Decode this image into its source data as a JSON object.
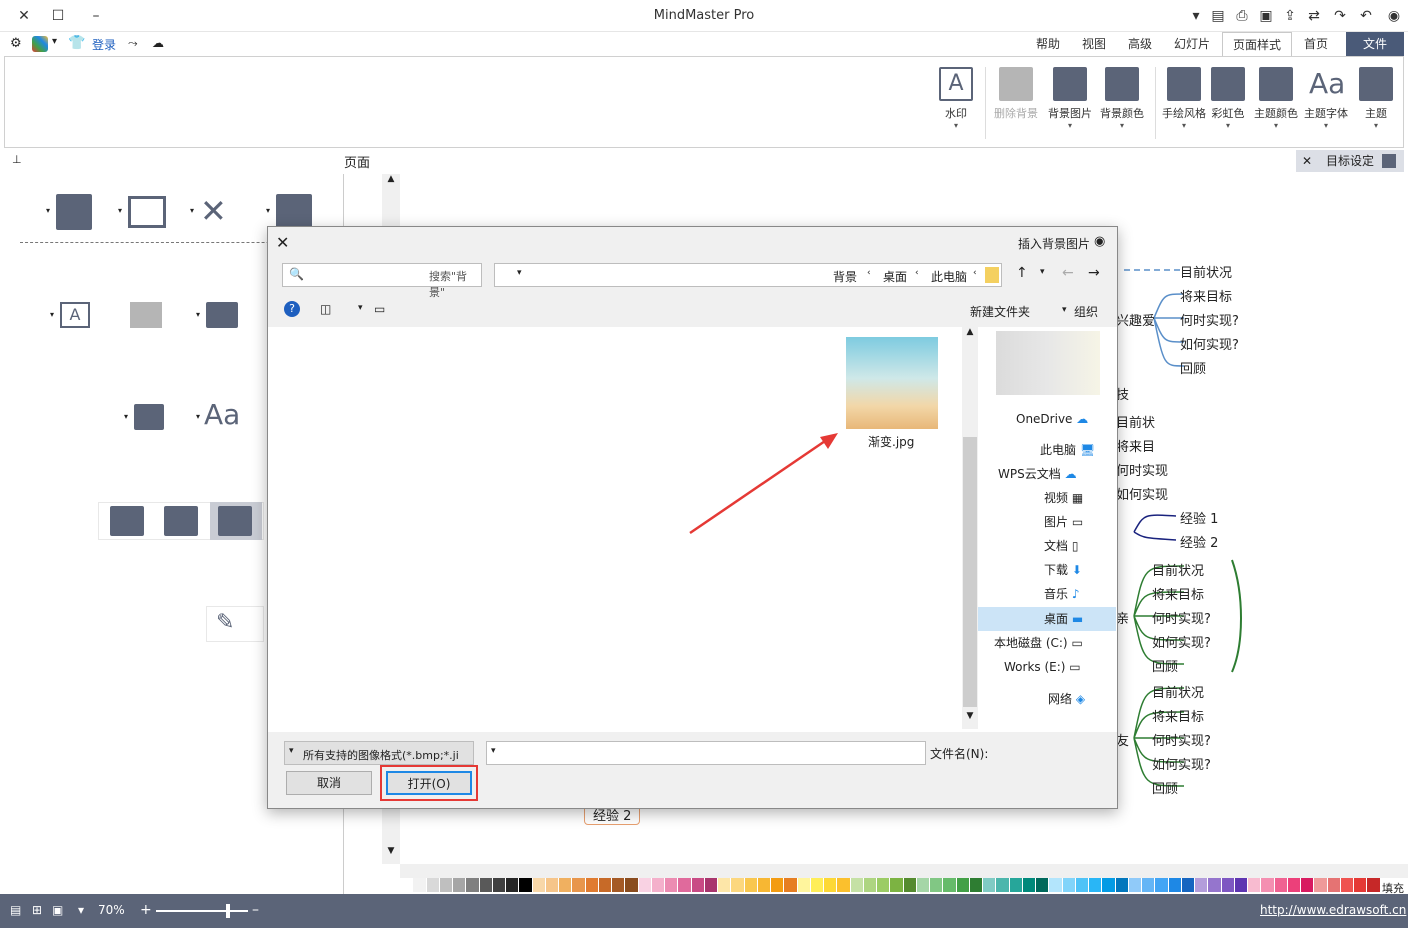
{
  "app": {
    "title": "MindMaster Pro"
  },
  "quick": {
    "login": "登录"
  },
  "tabs": [
    "文件",
    "首页",
    "页面样式",
    "幻灯片",
    "高级",
    "视图",
    "帮助"
  ],
  "ribbon": {
    "buttons": [
      {
        "label": "主题",
        "icon": "theme-icon"
      },
      {
        "label": "主题字体",
        "icon": "font-icon"
      },
      {
        "label": "主题颜色",
        "icon": "theme-color-icon"
      },
      {
        "label": "彩虹色",
        "icon": "rainbow-icon"
      },
      {
        "label": "手绘风格",
        "icon": "hand-drawn-icon"
      },
      {
        "label": "背景颜色",
        "icon": "bg-color-icon"
      },
      {
        "label": "背景图片",
        "icon": "bg-image-icon"
      },
      {
        "label": "删除背景",
        "icon": "delete-bg-icon"
      },
      {
        "label": "水印",
        "icon": "watermark-icon"
      }
    ]
  },
  "goal_panel": {
    "label": "目标设定"
  },
  "side_panel": {
    "title": "页面"
  },
  "dialog": {
    "title": "插入背景图片",
    "breadcrumb": [
      "此电脑",
      "桌面",
      "背景"
    ],
    "search_placeholder": "搜索\"背景\"",
    "organize": "组织",
    "new_folder": "新建文件夹",
    "nav_items": [
      "OneDrive",
      "此电脑",
      "WPS云文档",
      "视频",
      "图片",
      "文档",
      "下载",
      "音乐",
      "桌面",
      "本地磁盘 (C:)",
      "Works (E:)",
      "网络"
    ],
    "selected_nav": "桌面",
    "file": {
      "name": "渐变.jpg"
    },
    "filename_label": "文件名(N):",
    "filename_value": "",
    "filetype": "所有支持的图像格式(*.bmp;*.ji",
    "open_button": "打开(O)",
    "cancel_button": "取消"
  },
  "mindmap": {
    "nodes": [
      "目前状况",
      "将来目标",
      "何时实现?",
      "如何实现?",
      "回顾",
      "兴趣爱",
      "技",
      "目前状",
      "将来目",
      "何时实现",
      "如何实现",
      "经验 1",
      "经验 2",
      "目前状况",
      "将来目标",
      "何时实现?",
      "如何实现?",
      "回顾",
      "亲",
      "目前状况",
      "将来目标",
      "何时实现?",
      "如何实现?",
      "回顾",
      "友",
      "经验 2"
    ]
  },
  "status": {
    "zoom": "70%",
    "url": "http://www.edrawsoft.cn",
    "fill_label": "填充"
  },
  "colors": {
    "accent_dark": "#4a5a78",
    "highlight": "#e53935",
    "status_bg": "#5b6478"
  }
}
